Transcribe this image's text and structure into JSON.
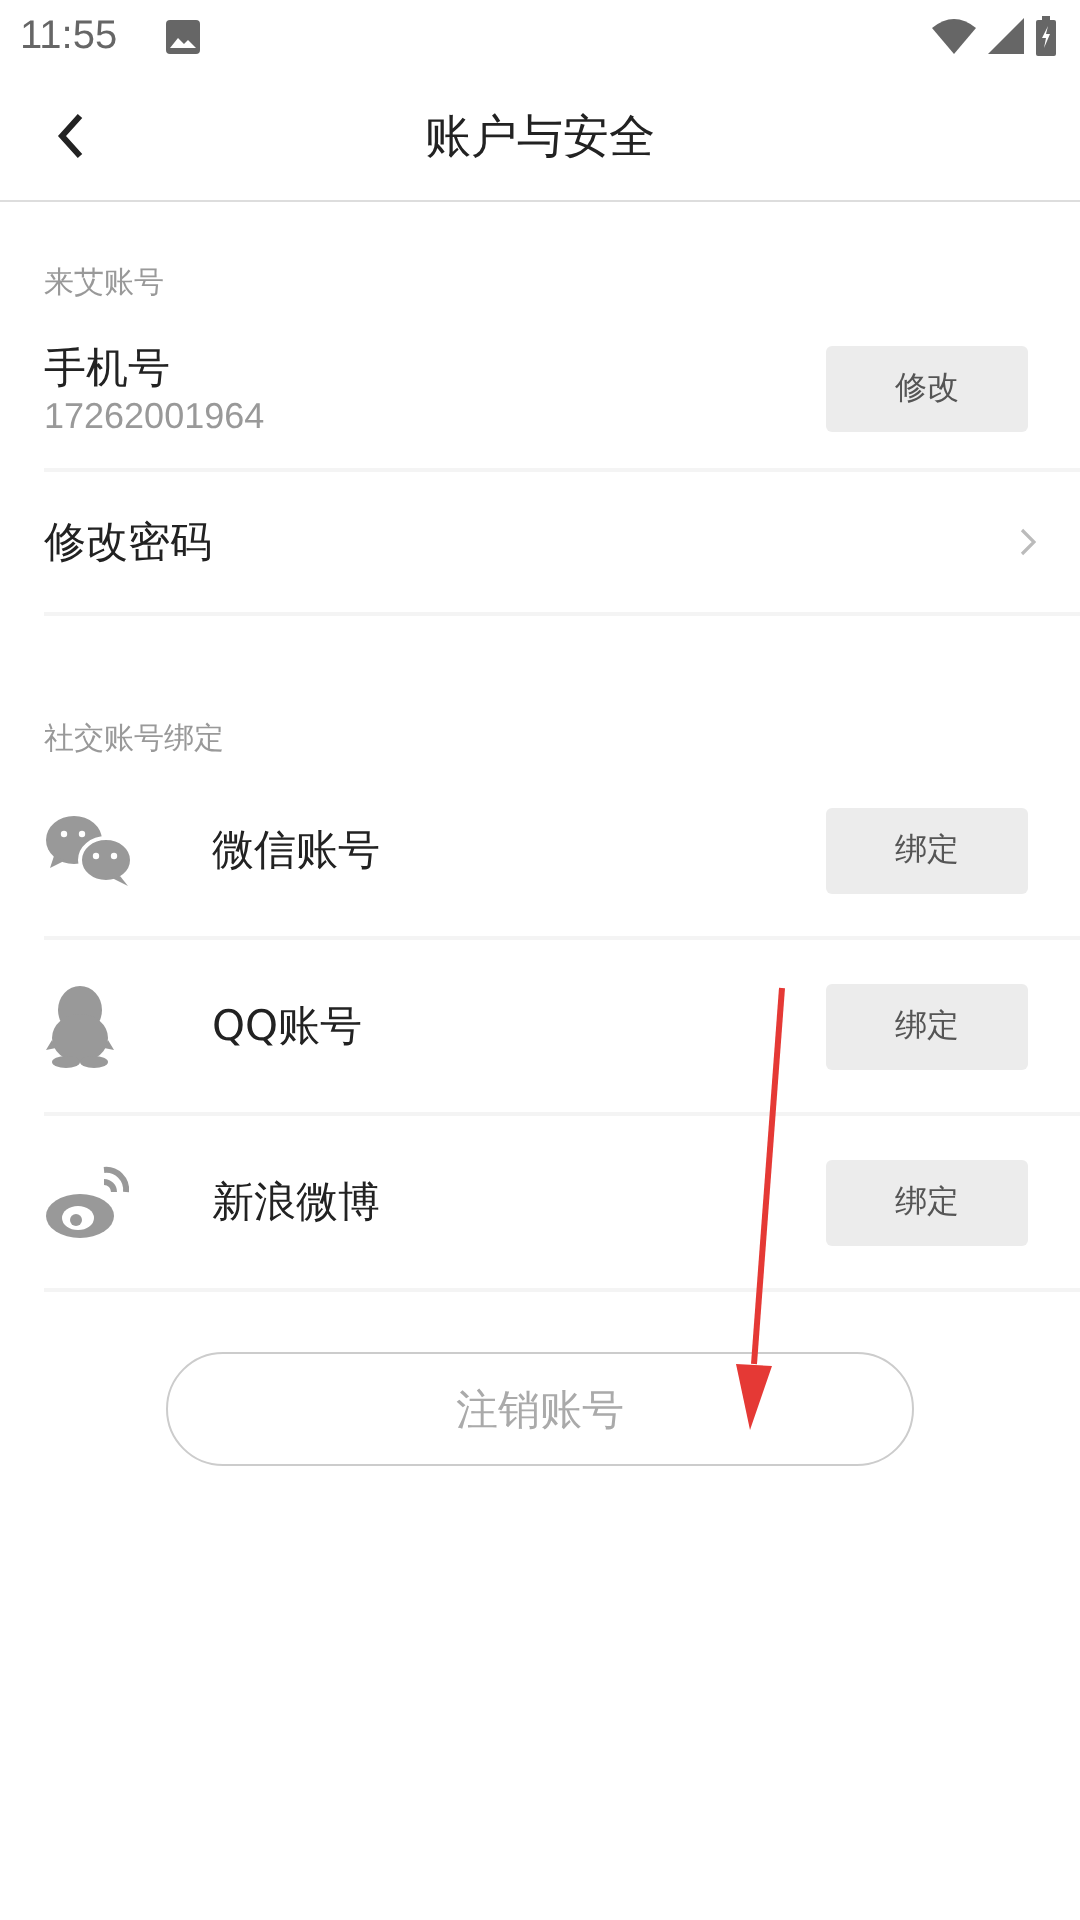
{
  "status_bar": {
    "time": "11:55"
  },
  "header": {
    "title": "账户与安全"
  },
  "sections": [
    {
      "label": "来艾账号",
      "rows": [
        {
          "kind": "action",
          "title": "手机号",
          "subtitle": "17262001964",
          "button": "修改"
        },
        {
          "kind": "link",
          "title": "修改密码"
        }
      ]
    },
    {
      "label": "社交账号绑定",
      "rows": [
        {
          "kind": "wechat",
          "title": "微信账号",
          "button": "绑定"
        },
        {
          "kind": "qq",
          "title": "QQ账号",
          "button": "绑定"
        },
        {
          "kind": "weibo",
          "title": "新浪微博",
          "button": "绑定"
        }
      ]
    }
  ],
  "cancel_button": "注销账号"
}
